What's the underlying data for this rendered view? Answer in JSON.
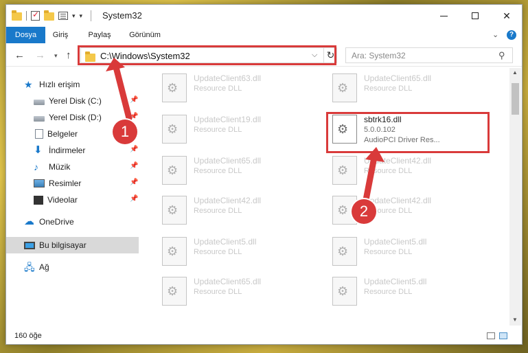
{
  "window": {
    "title": "System32"
  },
  "ribbon": {
    "tabs": [
      "Dosya",
      "Giriş",
      "Paylaş",
      "Görünüm"
    ],
    "help_glyph": "?"
  },
  "nav": {
    "back": "←",
    "forward": "→",
    "recent": "▾",
    "up": "↑"
  },
  "address": {
    "path": "C:\\Windows\\System32",
    "dropdown": "⌵",
    "refresh": "↻"
  },
  "search": {
    "placeholder": "Ara: System32",
    "icon": "⌕"
  },
  "sidebar": {
    "items": [
      {
        "label": "Hızlı erişim",
        "icon": "quick-access-icon",
        "pinned": false
      },
      {
        "label": "Yerel Disk (C:)",
        "icon": "disk-icon",
        "pinned": true
      },
      {
        "label": "Yerel Disk (D:)",
        "icon": "disk-icon",
        "pinned": true
      },
      {
        "label": "Belgeler",
        "icon": "documents-icon",
        "pinned": true
      },
      {
        "label": "İndirmeler",
        "icon": "downloads-icon",
        "pinned": true
      },
      {
        "label": "Müzik",
        "icon": "music-icon",
        "pinned": true
      },
      {
        "label": "Resimler",
        "icon": "pictures-icon",
        "pinned": true
      },
      {
        "label": "Videolar",
        "icon": "videos-icon",
        "pinned": true
      },
      {
        "label": "OneDrive",
        "icon": "onedrive-icon",
        "pinned": false
      },
      {
        "label": "Bu bilgisayar",
        "icon": "this-pc-icon",
        "pinned": false,
        "selected": true
      },
      {
        "label": "Ağ",
        "icon": "network-icon",
        "pinned": false
      }
    ]
  },
  "files": [
    {
      "name": "UpdateClient63.dll",
      "desc": "Resource DLL"
    },
    {
      "name": "UpdateClient65.dll",
      "desc": "Resource DLL"
    },
    {
      "name": "UpdateClient19.dll",
      "desc": "Resource DLL"
    },
    {
      "name": "sbtrk16.dll",
      "version": "5.0.0.102",
      "desc": "AudioPCI Driver Res...",
      "active": true
    },
    {
      "name": "UpdateClient65.dll",
      "desc": "Resource DLL"
    },
    {
      "name": "UpdateClient42.dll",
      "desc": "Resource DLL"
    },
    {
      "name": "UpdateClient42.dll",
      "desc": "Resource DLL"
    },
    {
      "name": "UpdateClient42.dll",
      "desc": "Resource DLL"
    },
    {
      "name": "UpdateClient5.dll",
      "desc": "Resource DLL"
    },
    {
      "name": "UpdateClient5.dll",
      "desc": "Resource DLL"
    },
    {
      "name": "UpdateClient65.dll",
      "desc": "Resource DLL"
    },
    {
      "name": "UpdateClient5.dll",
      "desc": "Resource DLL"
    }
  ],
  "status": {
    "count": "160 öğe"
  },
  "annotations": {
    "step1": "1",
    "step2": "2",
    "color": "#d93a3a"
  }
}
